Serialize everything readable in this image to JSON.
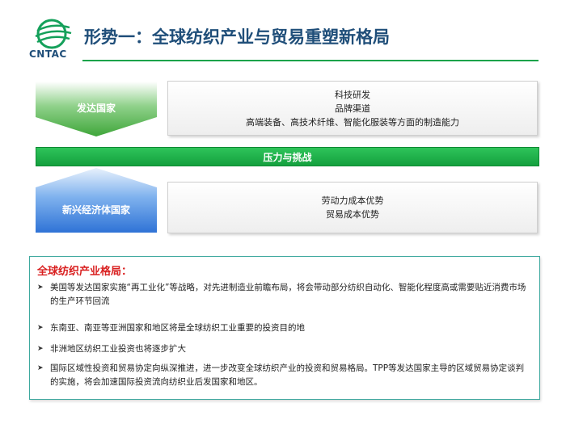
{
  "header": {
    "logo_text": "CNTAC",
    "title": "形势一：全球纺织产业与贸易重塑新格局"
  },
  "developed": {
    "label": "发达国家",
    "lines": [
      "科技研发",
      "品牌渠道",
      "高端装备、高技术纤维、智能化服装等方面的制造能力"
    ]
  },
  "pressure": {
    "label": "压力与挑战"
  },
  "emerging": {
    "label": "新兴经济体国家",
    "lines": [
      "劳动力成本优势",
      "贸易成本优势"
    ]
  },
  "pattern": {
    "title": "全球纺织产业格局：",
    "bullet_icon": "arrow-right-icon",
    "bullets": [
      "美国等发达国家实施“再工业化”等战略，对先进制造业前瞻布局，将会带动部分纺织自动化、智能化程度高或需要贴近消费市场的生产环节回流",
      "东南亚、南亚等亚洲国家和地区将是全球纺织工业重要的投资目的地",
      "非洲地区纺织工业投资也将逐步扩大",
      "国际区域性投资和贸易协定向纵深推进，进一步改变全球纺织产业的投资和贸易格局。TPP等发达国家主导的区域贸易协定谈判的实施，将会加速国际投资流向纺织业后发国家和地区。"
    ]
  },
  "colors": {
    "title": "#1f4e79",
    "green": "#16a34a",
    "blue": "#2f80e0",
    "pattern_title": "#d92020",
    "pattern_border": "#3ea99f"
  }
}
